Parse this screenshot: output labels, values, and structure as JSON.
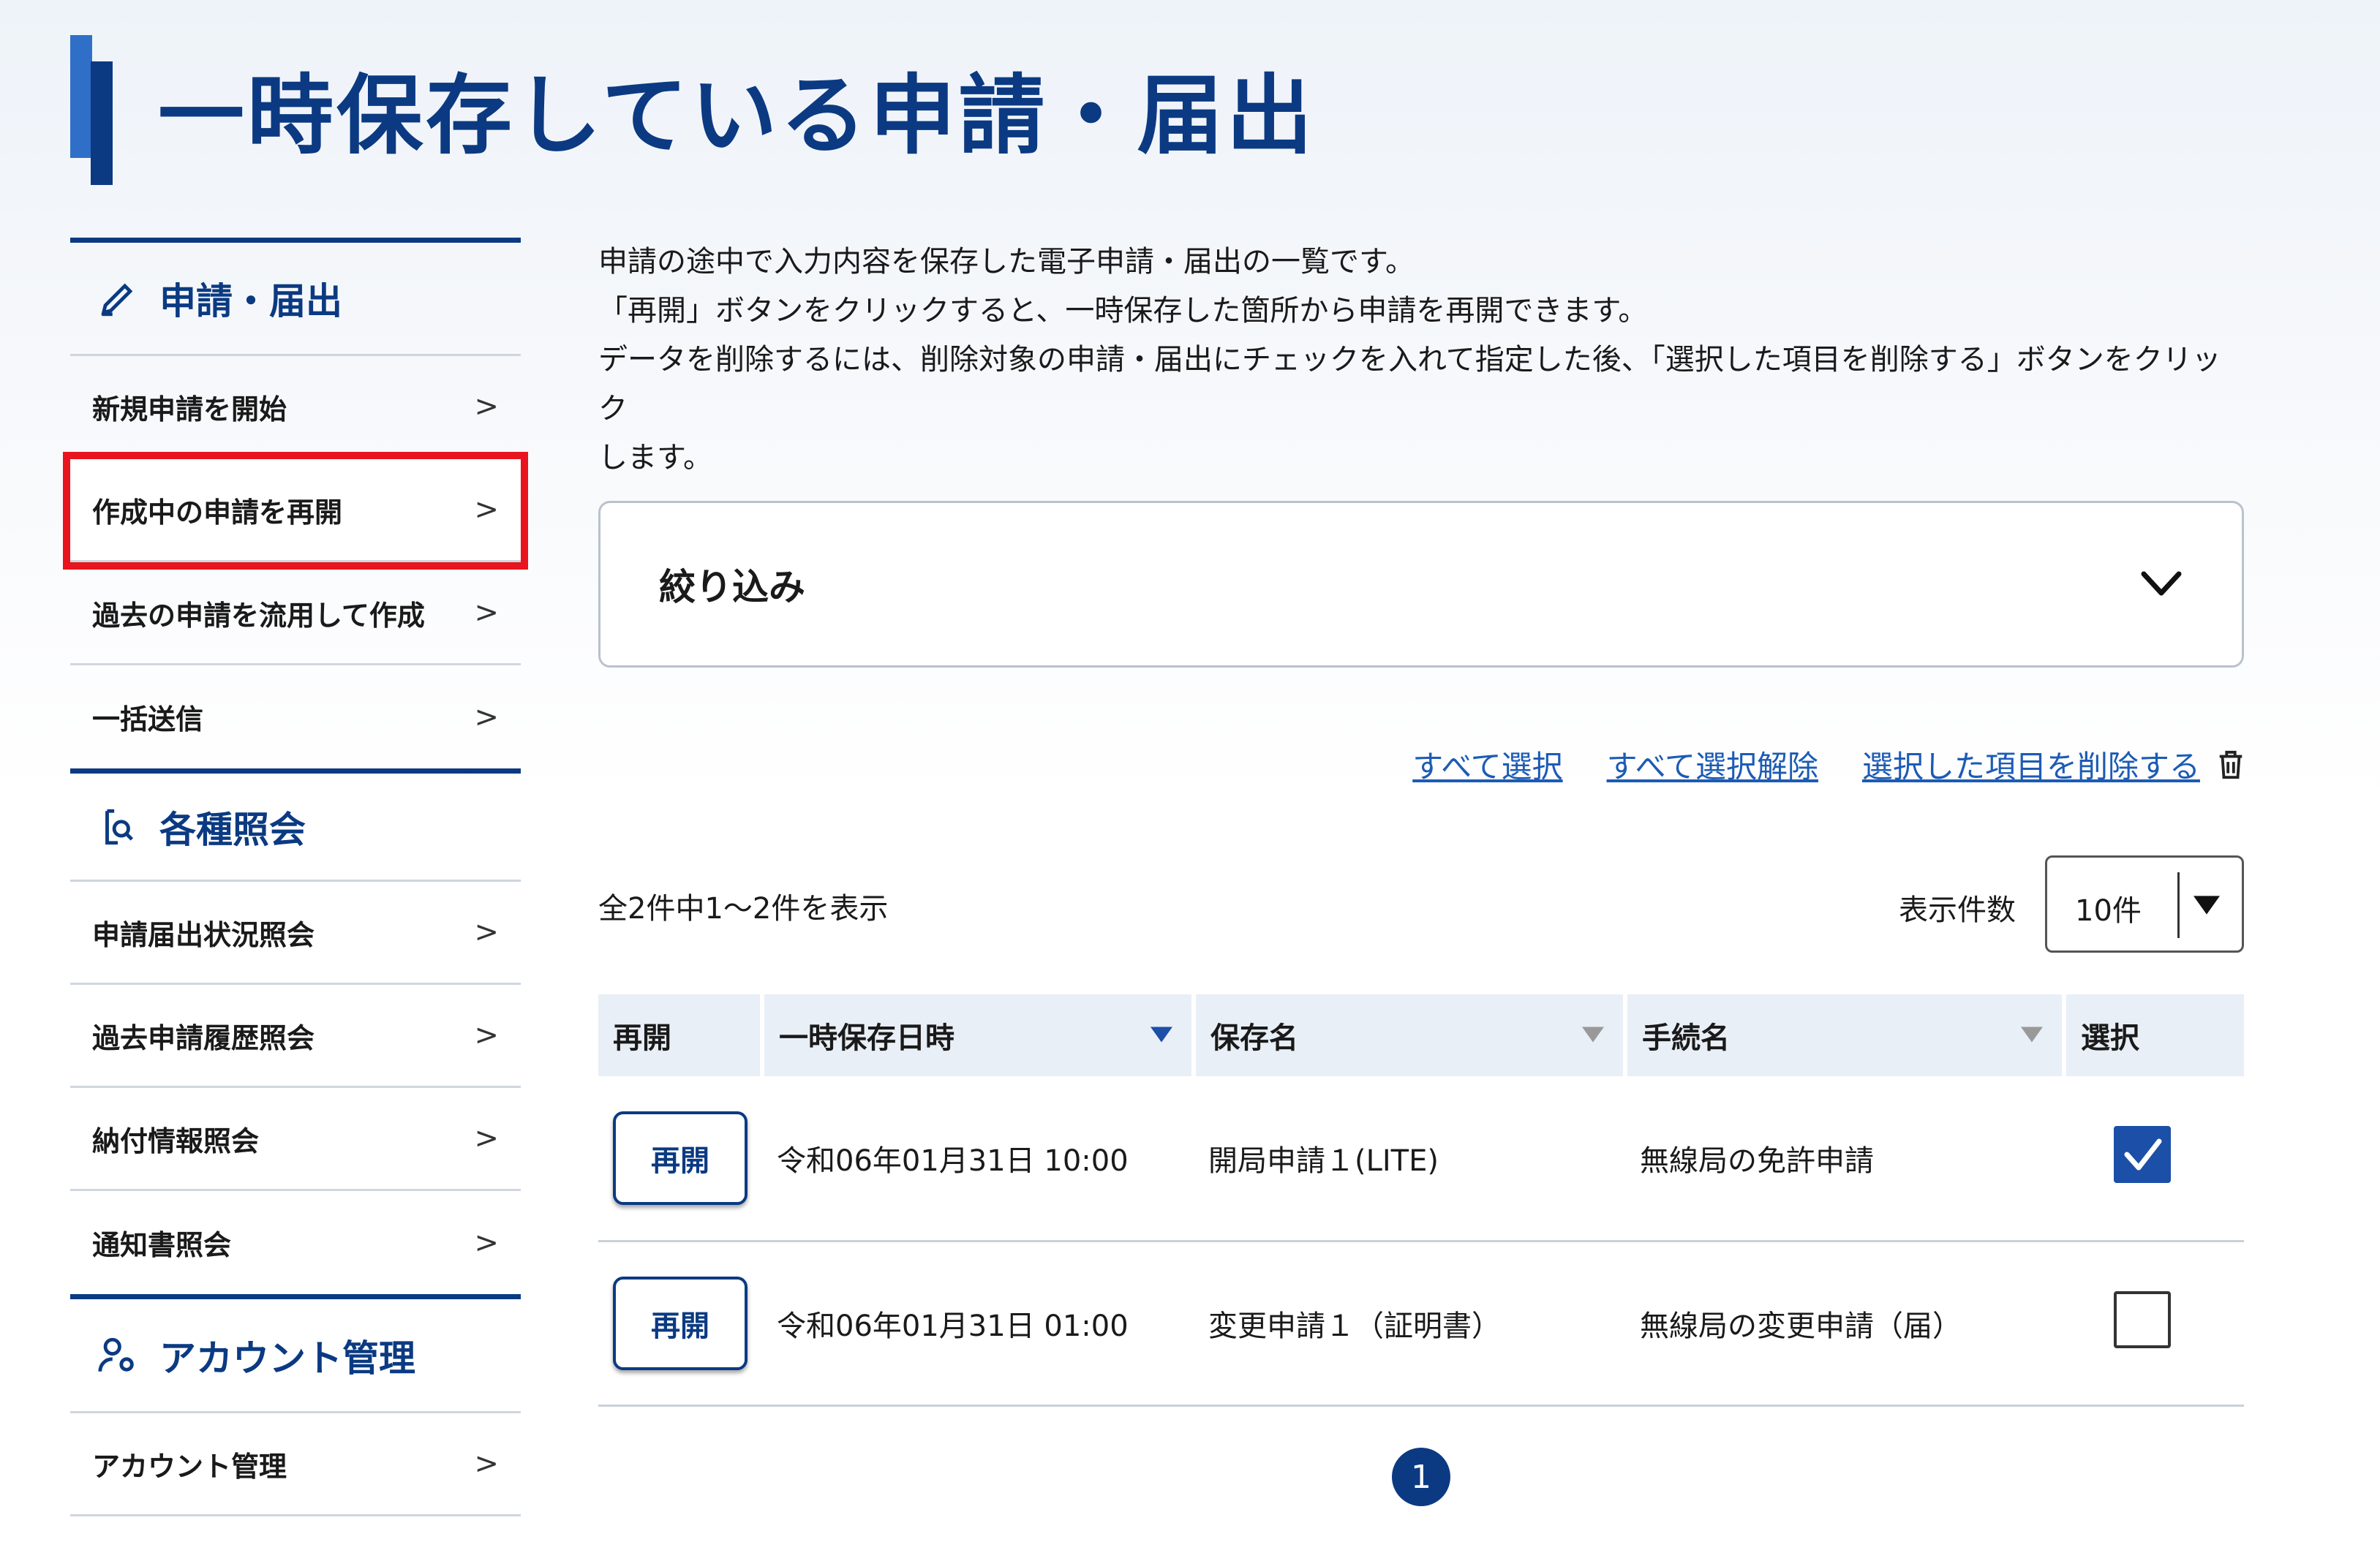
{
  "page": {
    "title": "一時保存している申請・届出"
  },
  "sidebar": {
    "sections": [
      {
        "heading": "申請・届出",
        "icon": "pencil-icon"
      },
      {
        "heading": "各種照会",
        "icon": "document-search-icon"
      },
      {
        "heading": "アカウント管理",
        "icon": "user-settings-icon"
      }
    ],
    "application_items": [
      {
        "label": "新規申請を開始"
      },
      {
        "label": "作成中の申請を再開"
      },
      {
        "label": "過去の申請を流用して作成"
      },
      {
        "label": "一括送信"
      }
    ],
    "inquiry_items": [
      {
        "label": "申請届出状況照会"
      },
      {
        "label": "過去申請履歴照会"
      },
      {
        "label": "納付情報照会"
      },
      {
        "label": "通知書照会"
      }
    ],
    "account_items": [
      {
        "label": "アカウント管理"
      }
    ],
    "chevron": ">"
  },
  "main": {
    "description": [
      "申請の途中で入力内容を保存した電子申請・届出の一覧です。",
      "「再開」ボタンをクリックすると、一時保存した箇所から申請を再開できます。",
      "データを削除するには、削除対象の申請・届出にチェックを入れて指定した後、「選択した項目を削除する」ボタンをクリック",
      "します。"
    ],
    "filter": {
      "label": "絞り込み"
    },
    "actions": {
      "select_all": "すべて選択",
      "deselect_all": "すべて選択解除",
      "delete_selected": "選択した項目を削除する"
    },
    "count_text": "全2件中1〜2件を表示",
    "per_page": {
      "label": "表示件数",
      "value": "10件"
    },
    "table": {
      "headers": {
        "resume": "再開",
        "saved_at": "一時保存日時",
        "save_name": "保存名",
        "procedure": "手続名",
        "select": "選択"
      },
      "rows": [
        {
          "button": "再開",
          "saved_at": "令和06年01月31日 10:00",
          "save_name": "開局申請１(LITE)",
          "procedure": "無線局の免許申請",
          "selected": true
        },
        {
          "button": "再開",
          "saved_at": "令和06年01月31日 01:00",
          "save_name": "変更申請１（証明書）",
          "procedure": "無線局の変更申請（届）",
          "selected": false
        }
      ]
    },
    "pagination": {
      "current": "1"
    }
  },
  "colors": {
    "primary": "#0b3a82",
    "link": "#1c5bb5",
    "highlight": "#e8141e",
    "checked": "#1b4fa8"
  }
}
